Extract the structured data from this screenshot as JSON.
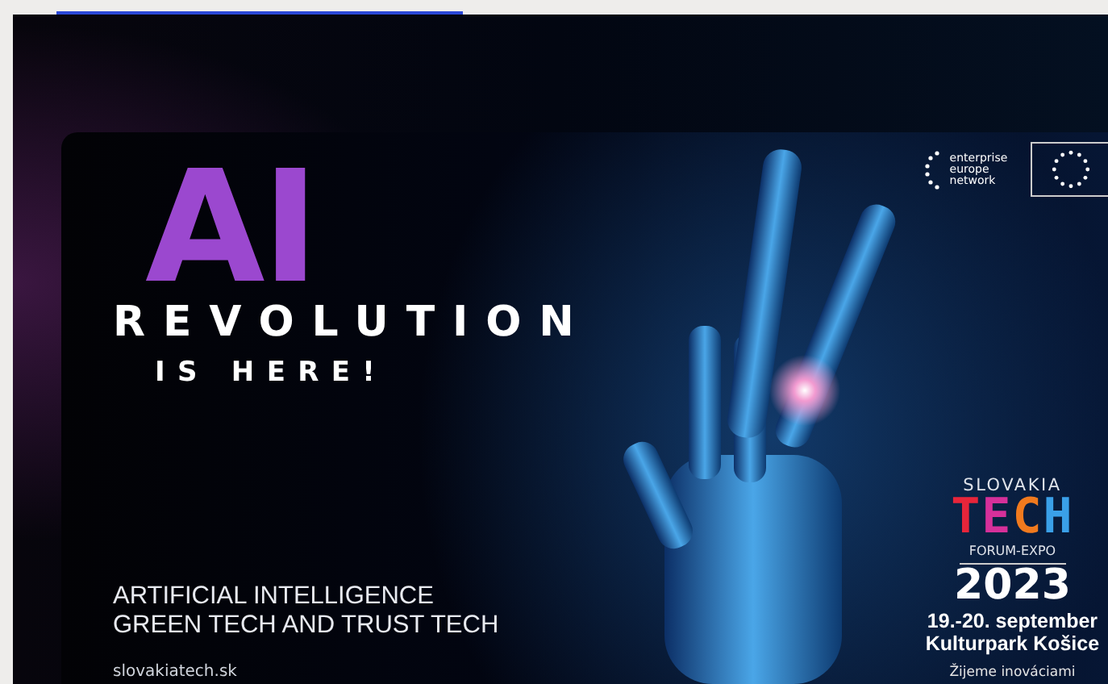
{
  "banner": {
    "graffiti": "AI",
    "headline": "REVOLUTION",
    "subheadline": "IS HERE!",
    "topics": [
      "ARTIFICIAL INTELLIGENCE",
      "GREEN TECH AND TRUST TECH"
    ],
    "website": "slovakiatech.sk",
    "partner_logo": [
      "enterprise",
      "europe",
      "network"
    ],
    "event": {
      "country": "SLOVAKIA",
      "logo_letters": [
        {
          "letter": "T",
          "color": "#e8253a"
        },
        {
          "letter": "E",
          "color": "#d6309a"
        },
        {
          "letter": "C",
          "color": "#f07a1e"
        },
        {
          "letter": "H",
          "color": "#3aa0e8"
        }
      ],
      "subtitle": "FORUM-EXPO",
      "year": "2023",
      "dates": "19.-20. september",
      "venue": "Kulturpark Košice",
      "slogan": "Žijeme inováciami"
    }
  }
}
